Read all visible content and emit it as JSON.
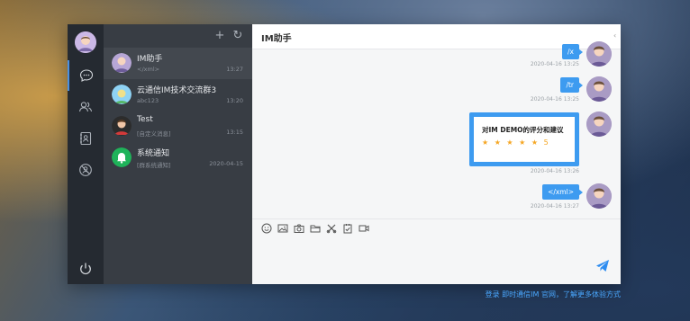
{
  "chat": {
    "title": "IM助手"
  },
  "sessions": [
    {
      "name": "IM助手",
      "preview": "</xml>",
      "time": "13:27"
    },
    {
      "name": "云通信IM技术交流群3",
      "preview": "abc123",
      "time": "13:20"
    },
    {
      "name": "Test",
      "preview": "[自定义消息]",
      "time": "13:15"
    },
    {
      "name": "系统通知",
      "preview": "[群系统通知]",
      "time": "2020-04-15"
    }
  ],
  "messages": [
    {
      "text": "/x",
      "time": "2020-04-16 13:25"
    },
    {
      "text": "/tr",
      "time": "2020-04-16 13:25"
    },
    {
      "card_title": "对IM DEMO的评分和建议",
      "stars": "★ ★ ★ ★ ★",
      "rating": "5",
      "time": "2020-04-16 13:26"
    },
    {
      "text": "</xml>",
      "time": "2020-04-16 13:27"
    }
  ],
  "footer": {
    "link": "登录 即时通信IM 官网，了解更多体验方式"
  },
  "colors": {
    "accent": "#3d9bf0",
    "star": "#f5a623",
    "nav_bg": "#252a31",
    "list_bg": "#383d44"
  },
  "icons": [
    "chat-icon",
    "contacts-icon",
    "address-book-icon",
    "blacklist-icon",
    "power-icon",
    "add-icon",
    "refresh-icon",
    "emoji-icon",
    "image-icon",
    "camera-icon",
    "folder-icon",
    "tools-icon",
    "checklist-icon",
    "video-icon",
    "send-icon"
  ]
}
